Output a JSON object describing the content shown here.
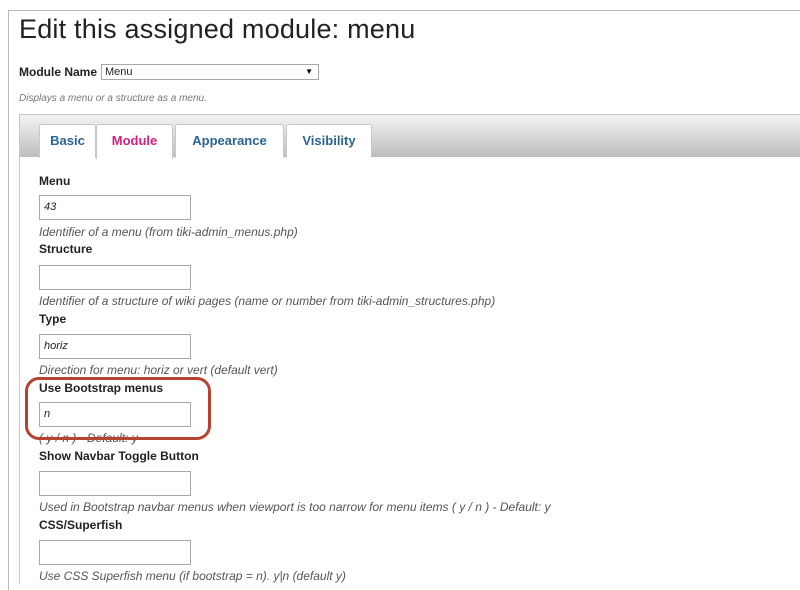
{
  "page_title": "Edit this assigned module: menu",
  "module_name": {
    "label": "Module Name",
    "value": "Menu"
  },
  "description": "Displays a menu or a structure as a menu.",
  "tabs": [
    {
      "label": "Basic",
      "active": false
    },
    {
      "label": "Module",
      "active": true
    },
    {
      "label": "Appearance",
      "active": false
    },
    {
      "label": "Visibility",
      "active": false
    }
  ],
  "fields": [
    {
      "label": "Menu",
      "value": "43",
      "help": "Identifier of a menu (from tiki-admin_menus.php)"
    },
    {
      "label": "Structure",
      "value": "",
      "help": "Identifier of a structure of wiki pages (name or number from tiki-admin_structures.php)"
    },
    {
      "label": "Type",
      "value": "horiz",
      "help": "Direction for menu: horiz or vert (default vert)"
    },
    {
      "label": "Use Bootstrap menus",
      "value": "n",
      "help": "( y / n ) - Default: y"
    },
    {
      "label": "Show Navbar Toggle Button",
      "value": "",
      "help": "Used in Bootstrap navbar menus when viewport is too narrow for menu items ( y / n ) - Default: y"
    },
    {
      "label": "CSS/Superfish",
      "value": "",
      "help": "Use CSS Superfish menu (if bootstrap = n). y|n (default y)"
    }
  ],
  "colors": {
    "active_tab": "#d6207a",
    "inactive_tab": "#2a6496",
    "highlight": "#b5432f"
  }
}
